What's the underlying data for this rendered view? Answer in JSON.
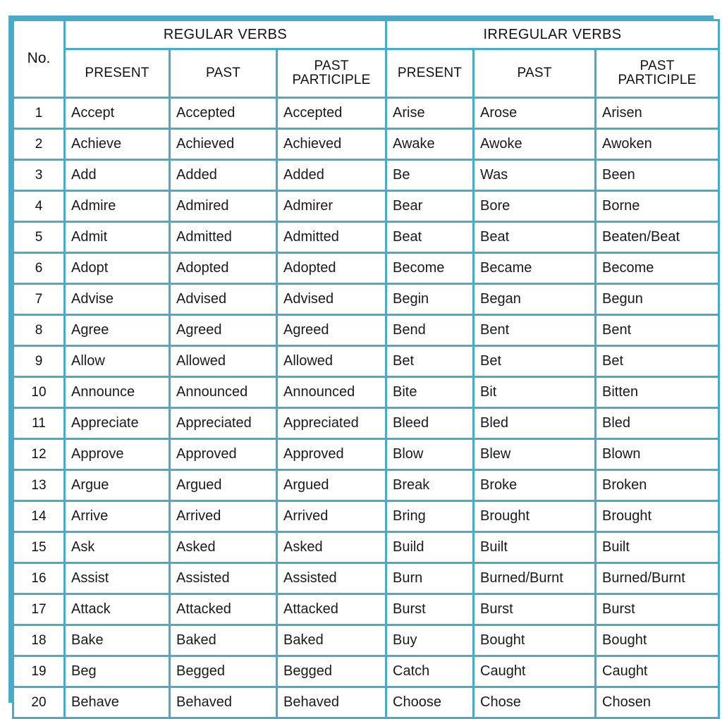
{
  "table": {
    "sections": [
      {
        "key": "regular",
        "label": "REGULAR VERBS"
      },
      {
        "key": "irregular",
        "label": "IRREGULAR VERBS"
      }
    ],
    "no_header": "No.",
    "column_headers": {
      "present": "PRESENT",
      "past": "PAST",
      "past_participle_line1": "PAST",
      "past_participle_line2": "PARTICIPLE"
    },
    "colors": {
      "border": "#4aabc6",
      "header_fill": "#daeaf2",
      "cell_fill": "#ffffff",
      "text": "#111111",
      "page_background": "#ffffff"
    },
    "rows": [
      {
        "no": "1",
        "regular": [
          "Accept",
          "Accepted",
          "Accepted"
        ],
        "irregular": [
          "Arise",
          "Arose",
          "Arisen"
        ]
      },
      {
        "no": "2",
        "regular": [
          "Achieve",
          "Achieved",
          "Achieved"
        ],
        "irregular": [
          "Awake",
          "Awoke",
          "Awoken"
        ]
      },
      {
        "no": "3",
        "regular": [
          "Add",
          "Added",
          "Added"
        ],
        "irregular": [
          "Be",
          "Was",
          "Been"
        ]
      },
      {
        "no": "4",
        "regular": [
          "Admire",
          "Admired",
          "Admirer"
        ],
        "irregular": [
          "Bear",
          "Bore",
          "Borne"
        ]
      },
      {
        "no": "5",
        "regular": [
          "Admit",
          "Admitted",
          "Admitted"
        ],
        "irregular": [
          "Beat",
          "Beat",
          "Beaten/Beat"
        ]
      },
      {
        "no": "6",
        "regular": [
          "Adopt",
          "Adopted",
          "Adopted"
        ],
        "irregular": [
          "Become",
          "Became",
          "Become"
        ]
      },
      {
        "no": "7",
        "regular": [
          "Advise",
          "Advised",
          "Advised"
        ],
        "irregular": [
          "Begin",
          "Began",
          "Begun"
        ]
      },
      {
        "no": "8",
        "regular": [
          "Agree",
          "Agreed",
          "Agreed"
        ],
        "irregular": [
          "Bend",
          "Bent",
          "Bent"
        ]
      },
      {
        "no": "9",
        "regular": [
          "Allow",
          "Allowed",
          "Allowed"
        ],
        "irregular": [
          "Bet",
          "Bet",
          "Bet"
        ]
      },
      {
        "no": "10",
        "regular": [
          "Announce",
          "Announced",
          "Announced"
        ],
        "irregular": [
          "Bite",
          "Bit",
          "Bitten"
        ]
      },
      {
        "no": "11",
        "regular": [
          "Appreciate",
          "Appreciated",
          "Appreciated"
        ],
        "irregular": [
          "Bleed",
          "Bled",
          "Bled"
        ]
      },
      {
        "no": "12",
        "regular": [
          "Approve",
          "Approved",
          "Approved"
        ],
        "irregular": [
          "Blow",
          "Blew",
          "Blown"
        ]
      },
      {
        "no": "13",
        "regular": [
          "Argue",
          "Argued",
          "Argued"
        ],
        "irregular": [
          "Break",
          "Broke",
          "Broken"
        ]
      },
      {
        "no": "14",
        "regular": [
          "Arrive",
          "Arrived",
          "Arrived"
        ],
        "irregular": [
          "Bring",
          "Brought",
          "Brought"
        ]
      },
      {
        "no": "15",
        "regular": [
          "Ask",
          "Asked",
          "Asked"
        ],
        "irregular": [
          "Build",
          "Built",
          "Built"
        ]
      },
      {
        "no": "16",
        "regular": [
          "Assist",
          "Assisted",
          "Assisted"
        ],
        "irregular": [
          "Burn",
          "Burned/Burnt",
          "Burned/Burnt"
        ]
      },
      {
        "no": "17",
        "regular": [
          "Attack",
          "Attacked",
          "Attacked"
        ],
        "irregular": [
          "Burst",
          "Burst",
          "Burst"
        ]
      },
      {
        "no": "18",
        "regular": [
          "Bake",
          "Baked",
          "Baked"
        ],
        "irregular": [
          "Buy",
          "Bought",
          "Bought"
        ]
      },
      {
        "no": "19",
        "regular": [
          "Beg",
          "Begged",
          "Begged"
        ],
        "irregular": [
          "Catch",
          "Caught",
          "Caught"
        ]
      },
      {
        "no": "20",
        "regular": [
          "Behave",
          "Behaved",
          "Behaved"
        ],
        "irregular": [
          "Choose",
          "Chose",
          "Chosen"
        ]
      }
    ]
  }
}
